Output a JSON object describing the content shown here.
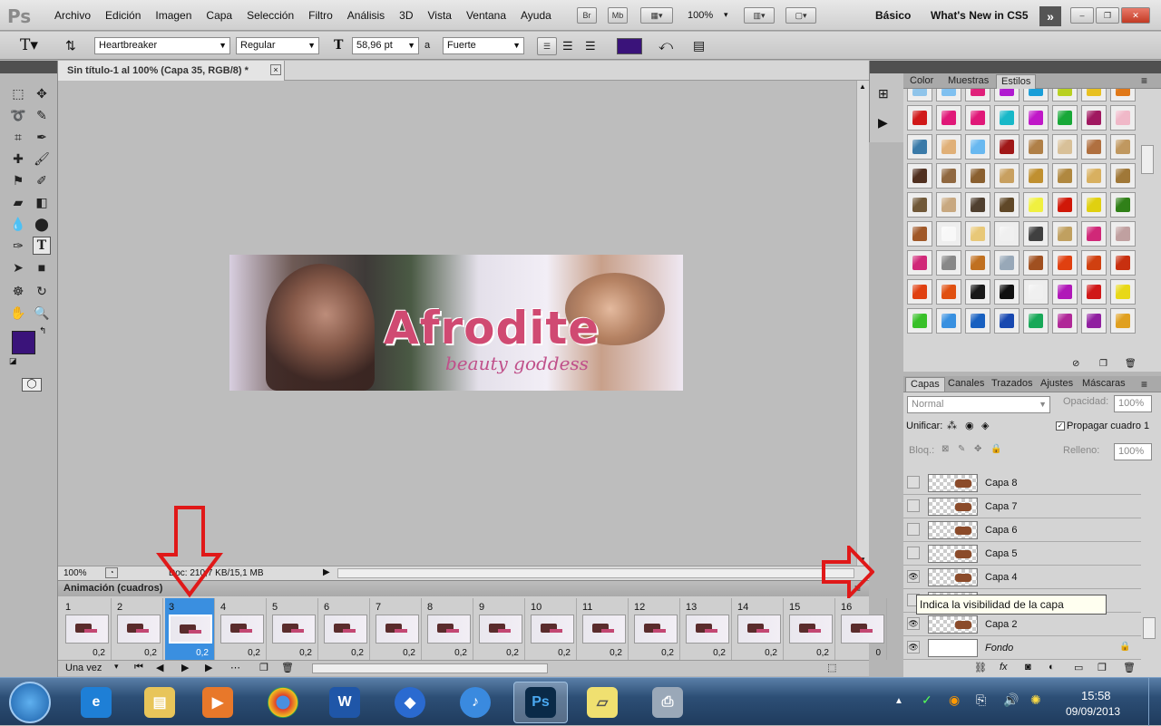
{
  "app": {
    "logo": "Ps"
  },
  "menu": [
    "Archivo",
    "Edición",
    "Imagen",
    "Capa",
    "Selección",
    "Filtro",
    "Análisis",
    "3D",
    "Vista",
    "Ventana",
    "Ayuda"
  ],
  "appbar": {
    "br": "Br",
    "mb": "Mb",
    "zoom": "100%"
  },
  "workspace": {
    "basic": "Básico",
    "whatsnew": "What's New in CS5"
  },
  "options": {
    "font_family": "Heartbreaker",
    "font_style": "Regular",
    "font_size": "58,96 pt",
    "aa_label": "a",
    "aa_method": "Fuerte",
    "text_color": "#3a137a"
  },
  "document": {
    "tab_title": "Sin título-1 al 100% (Capa 35, RGB/8) *",
    "close": "×"
  },
  "banner": {
    "title": "Afrodite",
    "subtitle": "beauty goddess"
  },
  "status": {
    "zoom": "100%",
    "doc_info": "Doc: 210,7 KB/15,1 MB"
  },
  "animation": {
    "title": "Animación (cuadros)",
    "frames": [
      {
        "n": "1",
        "d": "0,2"
      },
      {
        "n": "2",
        "d": "0,2"
      },
      {
        "n": "3",
        "d": "0,2"
      },
      {
        "n": "4",
        "d": "0,2"
      },
      {
        "n": "5",
        "d": "0,2"
      },
      {
        "n": "6",
        "d": "0,2"
      },
      {
        "n": "7",
        "d": "0,2"
      },
      {
        "n": "8",
        "d": "0,2"
      },
      {
        "n": "9",
        "d": "0,2"
      },
      {
        "n": "10",
        "d": "0,2"
      },
      {
        "n": "11",
        "d": "0,2"
      },
      {
        "n": "12",
        "d": "0,2"
      },
      {
        "n": "13",
        "d": "0,2"
      },
      {
        "n": "14",
        "d": "0,2"
      },
      {
        "n": "15",
        "d": "0,2"
      },
      {
        "n": "16",
        "d": "0"
      }
    ],
    "selected_frame": "3",
    "loop": "Una vez"
  },
  "styles_panel": {
    "tabs": [
      "Color",
      "Muestras",
      "Estilos"
    ],
    "active_tab": "Estilos",
    "swatches": [
      "#8fc4ea",
      "#7fc0f0",
      "#e0207a",
      "#b01ad0",
      "#1a9ed8",
      "#b8d020",
      "#e8c020",
      "#e07818",
      "#d01818",
      "#e01878",
      "#e01878",
      "#18b8c8",
      "#c018c8",
      "#18a838",
      "#a01860",
      "#f0b8c8",
      "#3a7aa8",
      "#e0b078",
      "#68b8f0",
      "#a01818",
      "#b08048",
      "#d8c098",
      "#b07040",
      "#c09860",
      "#503020",
      "#906840",
      "#8a6030",
      "#c8a060",
      "#c09030",
      "#b08840",
      "#d8b060",
      "#a07838",
      "#705838",
      "#c8a880",
      "#504030",
      "#604828",
      "#f0f040",
      "#d01808",
      "#e0d010",
      "#308018",
      "#a05828",
      "#f8f8f8",
      "#e8c878",
      "#f0f0f0",
      "#404040",
      "#c0a060",
      "#d02878",
      "#c0a0a0",
      "#d02878",
      "#888888",
      "#c07020",
      "#98a8b8",
      "#a05020",
      "#e04010",
      "#d04010",
      "#c83010",
      "#e04010",
      "#e05010",
      "#181818",
      "#101010",
      "#f0f0f0",
      "#b018b8",
      "#d01818",
      "#e8d818",
      "#38c028",
      "#3890e0",
      "#1860c0",
      "#1848b0",
      "#18a858",
      "#b02898",
      "#9020a0",
      "#e0a020"
    ]
  },
  "layers_panel": {
    "tabs": [
      "Capas",
      "Canales",
      "Trazados",
      "Ajustes",
      "Máscaras"
    ],
    "active_tab": "Capas",
    "blend": "Normal",
    "opacity_label": "Opacidad:",
    "opacity": "100%",
    "unify": "Unificar:",
    "propagate": "Propagar cuadro 1",
    "lock": "Bloq.:",
    "fill_label": "Relleno:",
    "fill": "100%",
    "layers": [
      {
        "name": "Capa 8",
        "visible": false
      },
      {
        "name": "Capa 7",
        "visible": false
      },
      {
        "name": "Capa 6",
        "visible": false
      },
      {
        "name": "Capa 5",
        "visible": false
      },
      {
        "name": "Capa 4",
        "visible": true
      },
      {
        "name": "Capa 3",
        "visible": false
      },
      {
        "name": "Capa 2",
        "visible": true
      },
      {
        "name": "Fondo",
        "visible": true
      }
    ]
  },
  "tooltip": "Indica la visibilidad de la capa",
  "clock": {
    "time": "15:58",
    "date": "09/09/2013"
  },
  "colors": {
    "foreground": "#3a137a",
    "arrow": "#e01818",
    "selection": "#3a8fe0"
  }
}
